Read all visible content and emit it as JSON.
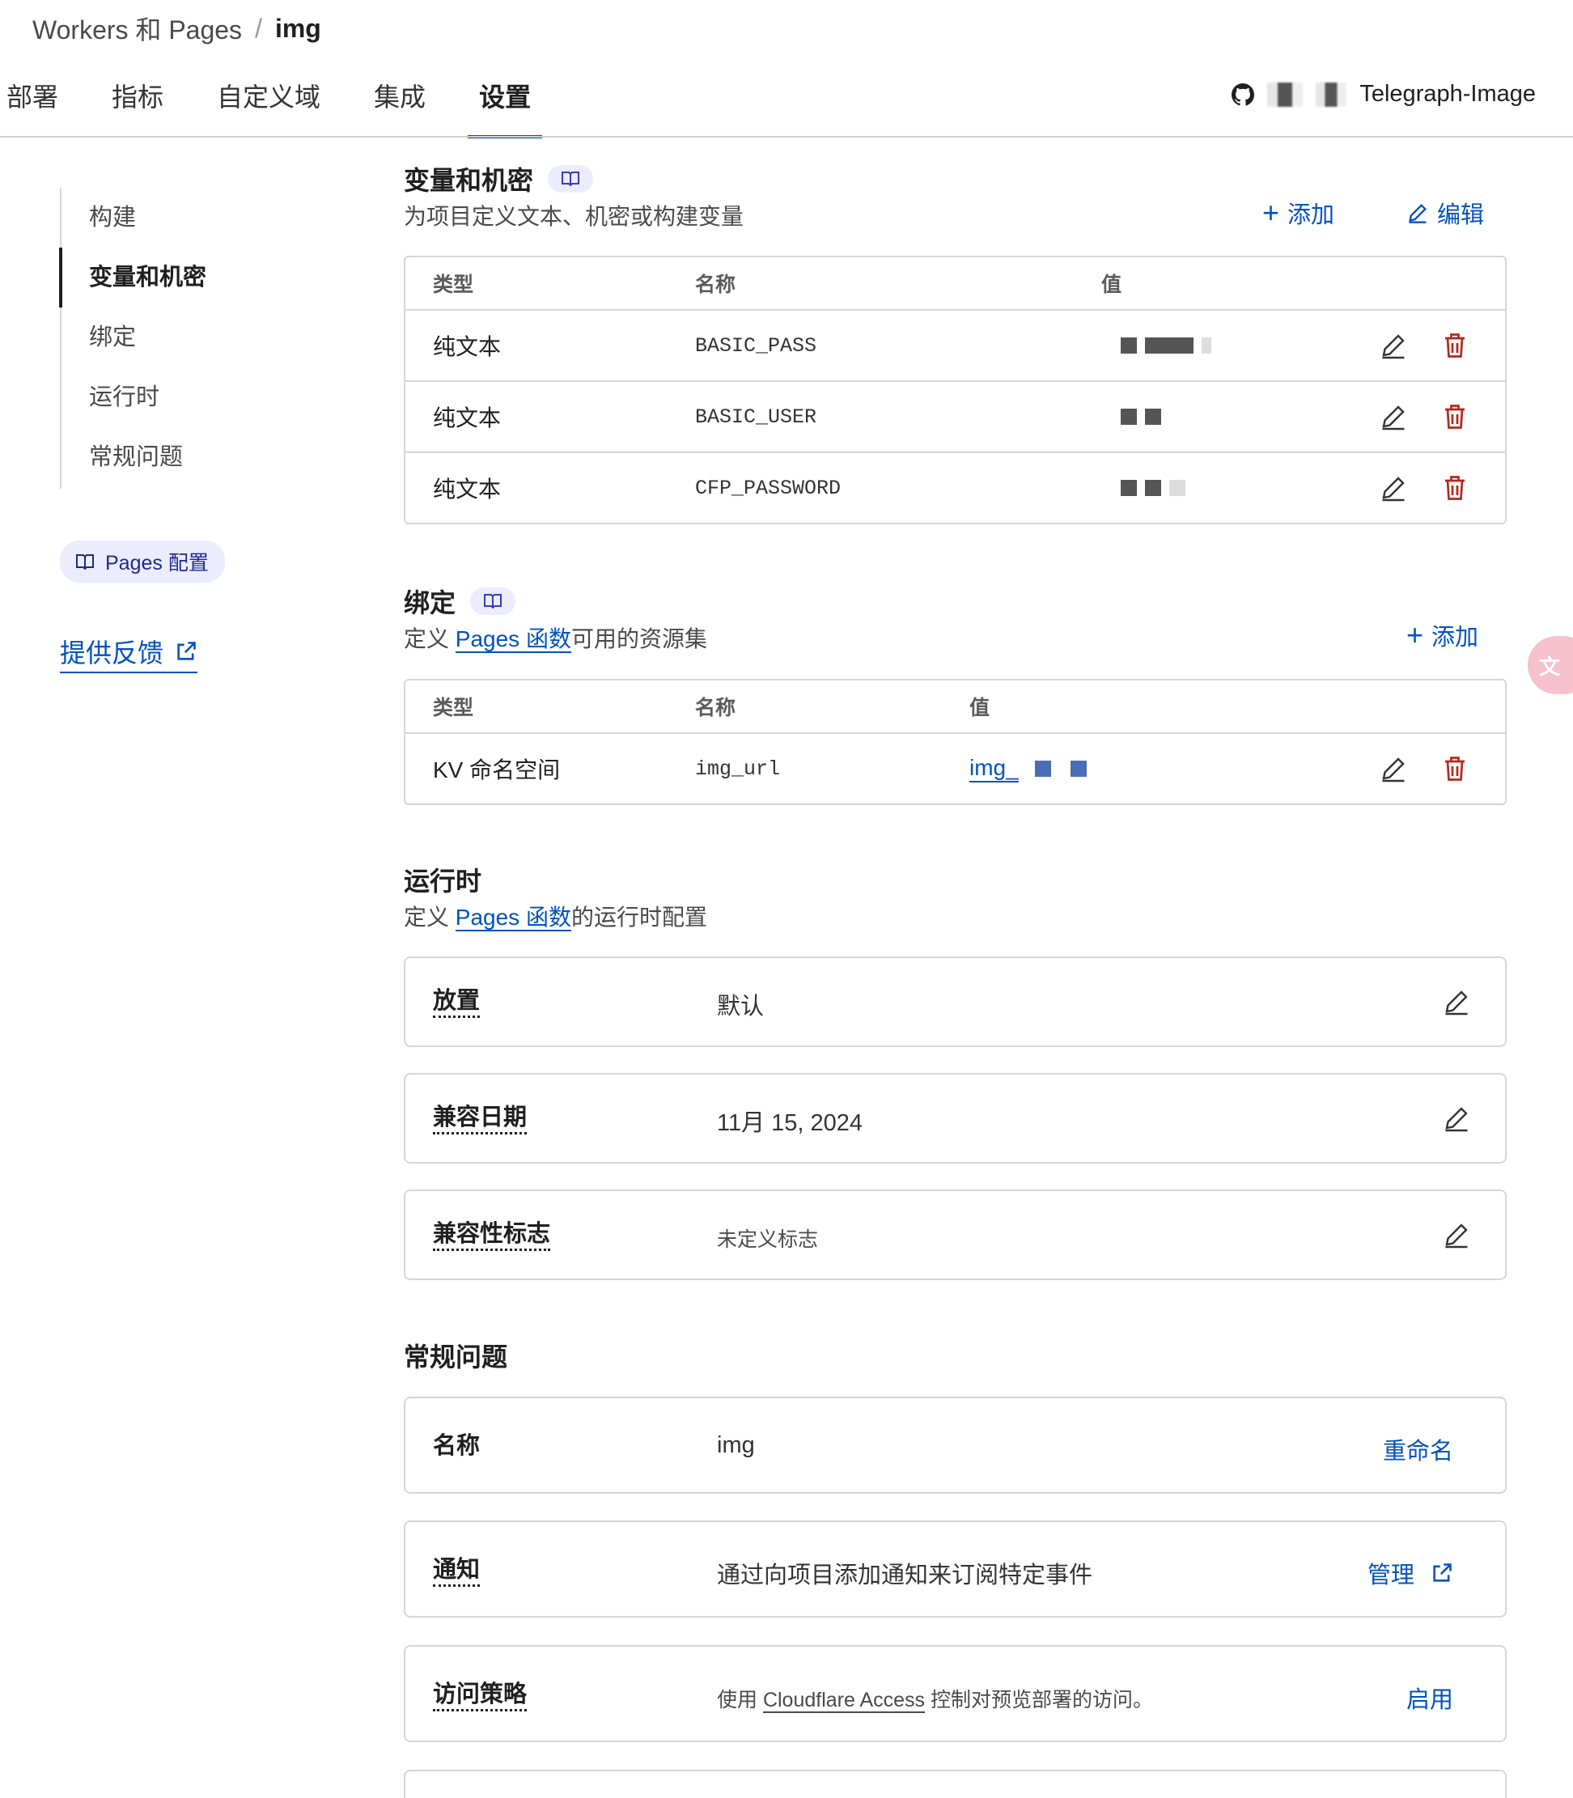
{
  "breadcrumb": {
    "parent": "Workers 和 Pages",
    "separator": "/",
    "current": "img"
  },
  "tabs": [
    "部署",
    "指标",
    "自定义域",
    "集成",
    "设置"
  ],
  "repo": {
    "name": "Telegraph-Image",
    "icon": "github-icon"
  },
  "sidebar": {
    "items": [
      "构建",
      "变量和机密",
      "绑定",
      "运行时",
      "常规问题"
    ],
    "pill_label": "Pages 配置",
    "feedback": "提供反馈"
  },
  "variables": {
    "title": "变量和机密",
    "subtitle": "为项目定义文本、机密或构建变量",
    "add": "添加",
    "edit": "编辑",
    "headers": [
      "类型",
      "名称",
      "值"
    ],
    "rows": [
      {
        "type": "纯文本",
        "name": "BASIC_PASS"
      },
      {
        "type": "纯文本",
        "name": "BASIC_USER"
      },
      {
        "type": "纯文本",
        "name": "CFP_PASSWORD"
      }
    ]
  },
  "bindings": {
    "title": "绑定",
    "sub_pre": "定义 ",
    "sub_link": "Pages 函数",
    "sub_post": "可用的资源集",
    "add": "添加",
    "headers": [
      "类型",
      "名称",
      "值"
    ],
    "rows": [
      {
        "type": "KV 命名空间",
        "name": "img_url",
        "value": "img_"
      }
    ]
  },
  "runtime": {
    "title": "运行时",
    "sub_pre": "定义 ",
    "sub_link": "Pages 函数",
    "sub_post": "的运行时配置",
    "cards": [
      {
        "label": "放置",
        "value": "默认"
      },
      {
        "label": "兼容日期",
        "value": "11月 15, 2024"
      },
      {
        "label": "兼容性标志",
        "value": "未定义标志"
      }
    ]
  },
  "general": {
    "title": "常规问题",
    "name_label": "名称",
    "name_value": "img",
    "rename": "重命名",
    "notify_label": "通知",
    "notify_value": "通过向项目添加通知来订阅特定事件",
    "manage": "管理",
    "access_label": "访问策略",
    "access_pre": "使用 ",
    "access_link": "Cloudflare Access",
    "access_post": " 控制对预览部署的访问。",
    "enable": "启用"
  },
  "colors": {
    "accent": "#0051c3",
    "danger": "#b5271b",
    "border": "#d6d6d6"
  }
}
